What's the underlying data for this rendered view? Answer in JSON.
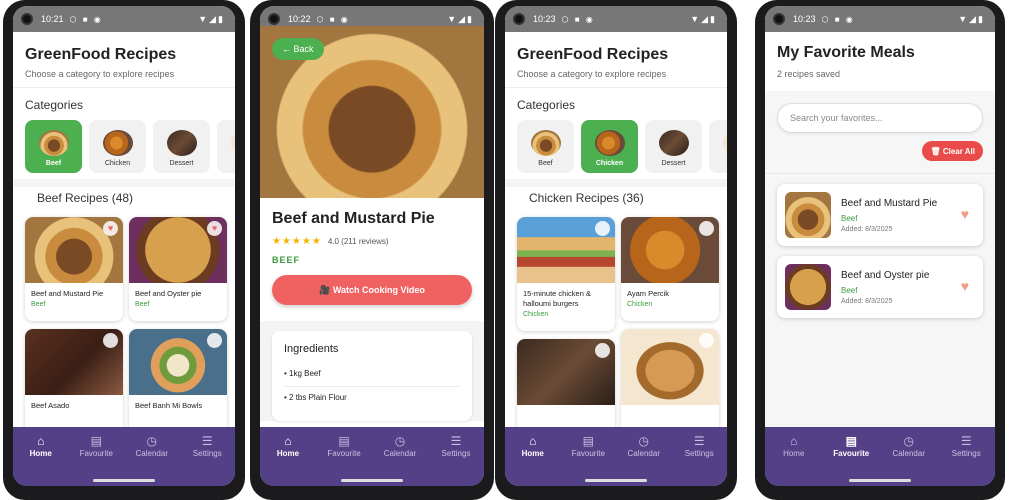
{
  "nav": [
    {
      "label": "Home",
      "icon": "home-icon",
      "glyph": "⌂"
    },
    {
      "label": "Favourite",
      "icon": "clipboard-icon",
      "glyph": "▤"
    },
    {
      "label": "Calendar",
      "icon": "clock-icon",
      "glyph": "◷"
    },
    {
      "label": "Settings",
      "icon": "menu-icon",
      "glyph": "☰"
    }
  ],
  "phones": [
    {
      "time": "10:21",
      "active_nav": 0
    },
    {
      "time": "10:22",
      "active_nav": 0
    },
    {
      "time": "10:23",
      "active_nav": 0
    },
    {
      "time": "10:23",
      "active_nav": 1
    }
  ],
  "home": {
    "title": "GreenFood Recipes",
    "subtitle": "Choose a category to explore recipes",
    "categories_label": "Categories",
    "categories": [
      "Beef",
      "Chicken",
      "Dessert",
      "L"
    ]
  },
  "beef_screen": {
    "active_category": "Beef",
    "section": "Beef Recipes (48)",
    "recipes": [
      {
        "name": "Beef and Mustard Pie",
        "category": "Beef",
        "favorite": true
      },
      {
        "name": "Beef and Oyster pie",
        "category": "Beef",
        "favorite": true
      },
      {
        "name": "Beef Asado",
        "category": "",
        "favorite": false
      },
      {
        "name": "Beef Banh Mi Bowls",
        "category": "",
        "favorite": false
      }
    ]
  },
  "detail": {
    "back": "← Back",
    "title": "Beef and Mustard Pie",
    "stars": "★★★★★",
    "rating": "4.0 (211 reviews)",
    "category": "BEEF",
    "watch_button": "🎥 Watch Cooking Video",
    "ingredients_title": "Ingredients",
    "ingredients": [
      "• 1kg Beef",
      "• 2 tbs Plain Flour"
    ]
  },
  "chicken_screen": {
    "active_category": "Chicken",
    "section": "Chicken Recipes (36)",
    "recipes": [
      {
        "name": "15-minute chicken & halloumi burgers",
        "category": "Chicken",
        "favorite": false
      },
      {
        "name": "Ayam Percik",
        "category": "Chicken",
        "favorite": false
      },
      {
        "name": "",
        "category": "",
        "favorite": false
      },
      {
        "name": "",
        "category": "",
        "favorite": false
      }
    ]
  },
  "favorites": {
    "title": "My Favorite Meals",
    "count": "2 recipes saved",
    "search_placeholder": "Search your favorites...",
    "clear_all": "🗑 Clear All",
    "items": [
      {
        "name": "Beef and Mustard Pie",
        "category": "Beef",
        "added": "Added: 8/3/2025"
      },
      {
        "name": "Beef and Oyster pie",
        "category": "Beef",
        "added": "Added: 8/3/2025"
      }
    ]
  },
  "colors": {
    "accent_green": "#4caf50",
    "nav_purple": "#544087",
    "button_red": "#f06262",
    "clear_red": "#e94b4b"
  }
}
